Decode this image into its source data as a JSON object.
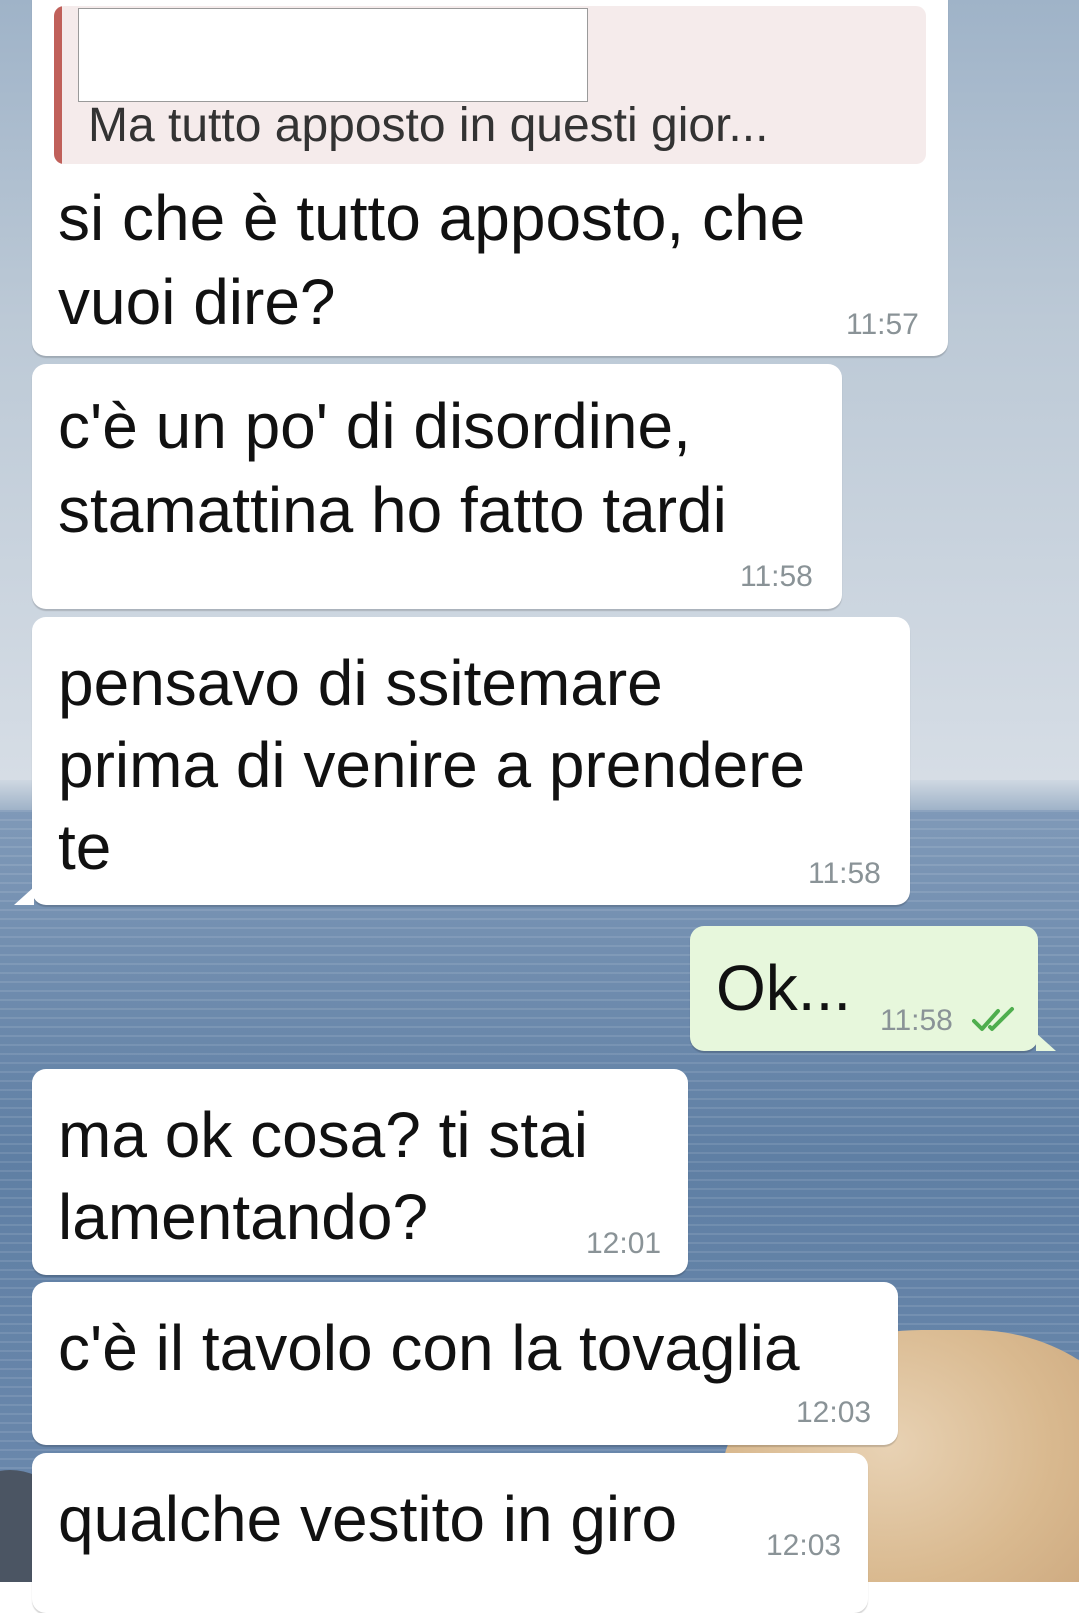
{
  "chat": {
    "quoted_reply": {
      "text": "Ma tutto apposto in questi gior..."
    },
    "messages": [
      {
        "direction": "in",
        "lines": [
          "si che è tutto apposto, che",
          "vuoi dire?"
        ],
        "time": "11:57"
      },
      {
        "direction": "in",
        "lines": [
          "c'è un po' di disordine,",
          "stamattina ho fatto tardi"
        ],
        "time": "11:58"
      },
      {
        "direction": "in",
        "lines": [
          "pensavo di ssitemare",
          "prima di venire a prendere",
          "te"
        ],
        "time": "11:58"
      },
      {
        "direction": "out",
        "lines": [
          "Ok..."
        ],
        "time": "11:58",
        "status": "double-check-read"
      },
      {
        "direction": "in",
        "lines": [
          "ma ok cosa? ti stai",
          "lamentando?"
        ],
        "time": "12:01"
      },
      {
        "direction": "in",
        "lines": [
          "c'è il tavolo con la tovaglia"
        ],
        "time": "12:03"
      },
      {
        "direction": "in",
        "lines": [
          "qualche vestito in giro"
        ],
        "time": "12:03"
      }
    ]
  },
  "colors": {
    "incoming_bubble": "#ffffff",
    "outgoing_bubble": "#e7f7dc",
    "quote_bar": "#c0605a",
    "read_check": "#4fae4e",
    "timestamp": "#8a9397"
  }
}
